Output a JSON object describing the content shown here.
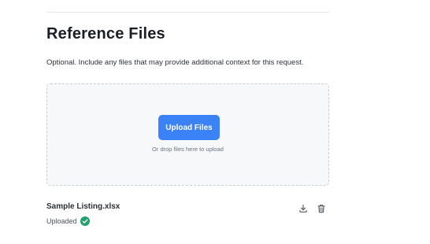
{
  "section": {
    "title": "Reference Files",
    "description": "Optional. Include any files that may provide additional context for this request."
  },
  "dropzone": {
    "button_label": "Upload Files",
    "hint": "Or drop files here to upload"
  },
  "file": {
    "name": "Sample Listing.xlsx",
    "status": "Uploaded",
    "icons": {
      "status": "check-circle-icon",
      "download": "download-icon",
      "delete": "trash-icon"
    }
  },
  "colors": {
    "accent": "#3b82f6",
    "success": "#22a06b",
    "dropzone_bg": "#f7f8fa"
  }
}
